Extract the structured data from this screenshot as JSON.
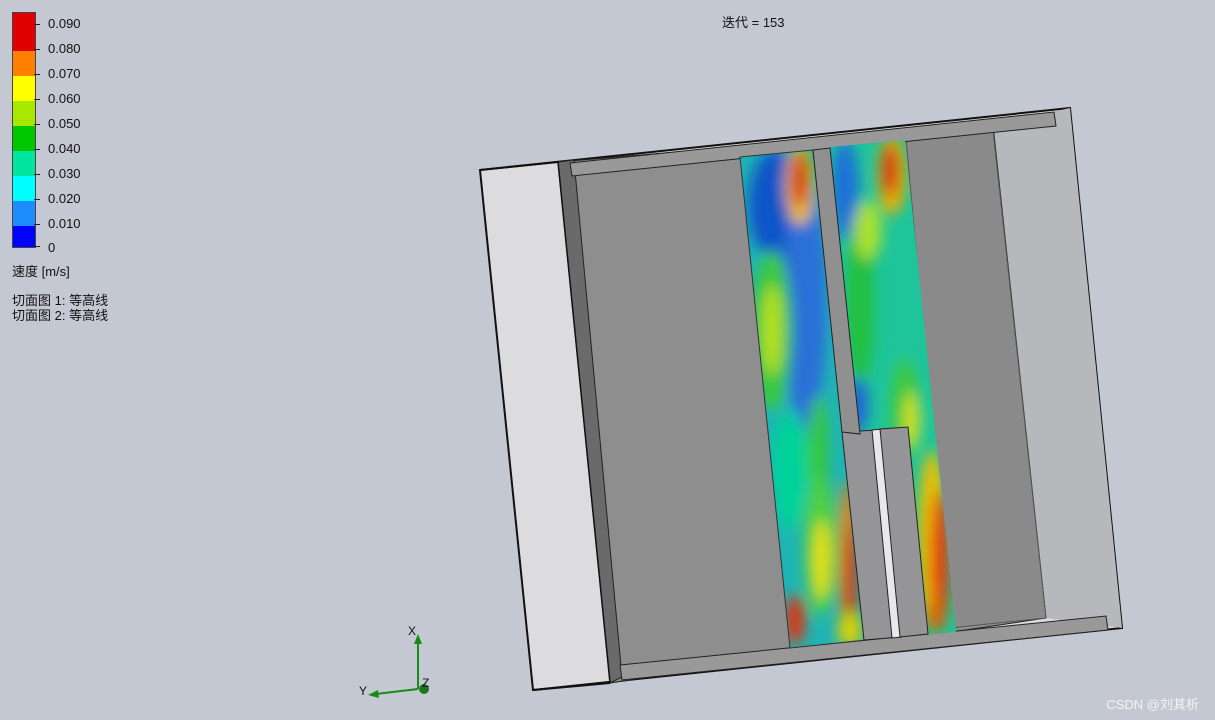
{
  "legend": {
    "ticks": [
      "0.090",
      "0.080",
      "0.070",
      "0.060",
      "0.050",
      "0.040",
      "0.030",
      "0.020",
      "0.010",
      "0"
    ],
    "colors": [
      "#e00000",
      "#ff7f00",
      "#ffff00",
      "#a8e800",
      "#00c800",
      "#00e6a0",
      "#00ffff",
      "#1e8cff",
      "#0000ff"
    ],
    "unit_label": "速度 [m/s]",
    "cut_plots": [
      "切面图 1: 等高线",
      "切面图 2: 等高线"
    ]
  },
  "iteration_label": "迭代 = 153",
  "triad": {
    "x": "X",
    "y": "Y",
    "z": "Z"
  },
  "watermark": "CSDN @刘其析"
}
